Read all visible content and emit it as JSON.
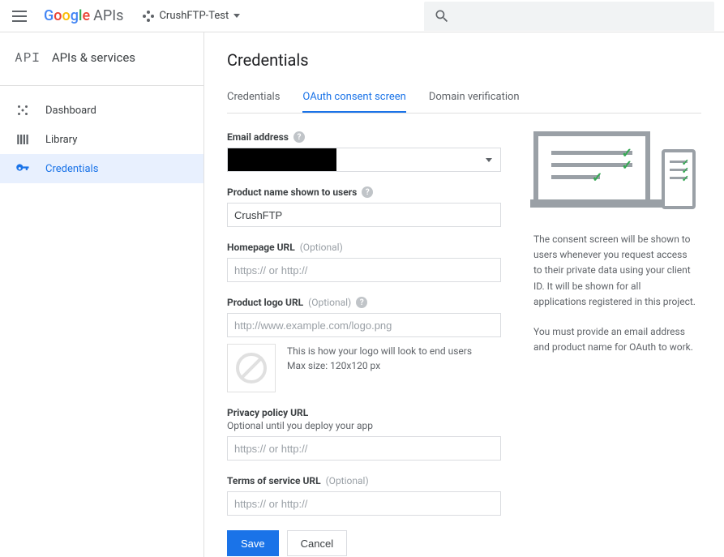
{
  "header": {
    "logo_text": "Google",
    "logo_suffix": "APIs",
    "project_name": "CrushFTP-Test"
  },
  "sidebar": {
    "mark": "API",
    "title": "APIs & services",
    "items": [
      {
        "label": "Dashboard"
      },
      {
        "label": "Library"
      },
      {
        "label": "Credentials"
      }
    ]
  },
  "page": {
    "title": "Credentials",
    "tabs": [
      {
        "label": "Credentials"
      },
      {
        "label": "OAuth consent screen"
      },
      {
        "label": "Domain verification"
      }
    ]
  },
  "form": {
    "email_label": "Email address",
    "product_label": "Product name shown to users",
    "product_value": "CrushFTP",
    "homepage_label": "Homepage URL",
    "homepage_optional": "(Optional)",
    "homepage_placeholder": "https:// or http://",
    "logo_label": "Product logo URL",
    "logo_optional": "(Optional)",
    "logo_placeholder": "http://www.example.com/logo.png",
    "logo_hint1": "This is how your logo will look to end users",
    "logo_hint2": "Max size: 120x120 px",
    "privacy_label": "Privacy policy URL",
    "privacy_sub": "Optional until you deploy your app",
    "privacy_placeholder": "https:// or http://",
    "tos_label": "Terms of service URL",
    "tos_optional": "(Optional)",
    "tos_placeholder": "https:// or http://",
    "save": "Save",
    "cancel": "Cancel"
  },
  "info": {
    "p1": "The consent screen will be shown to users whenever you request access to their private data using your client ID. It will be shown for all applications registered in this project.",
    "p2": "You must provide an email address and product name for OAuth to work."
  }
}
